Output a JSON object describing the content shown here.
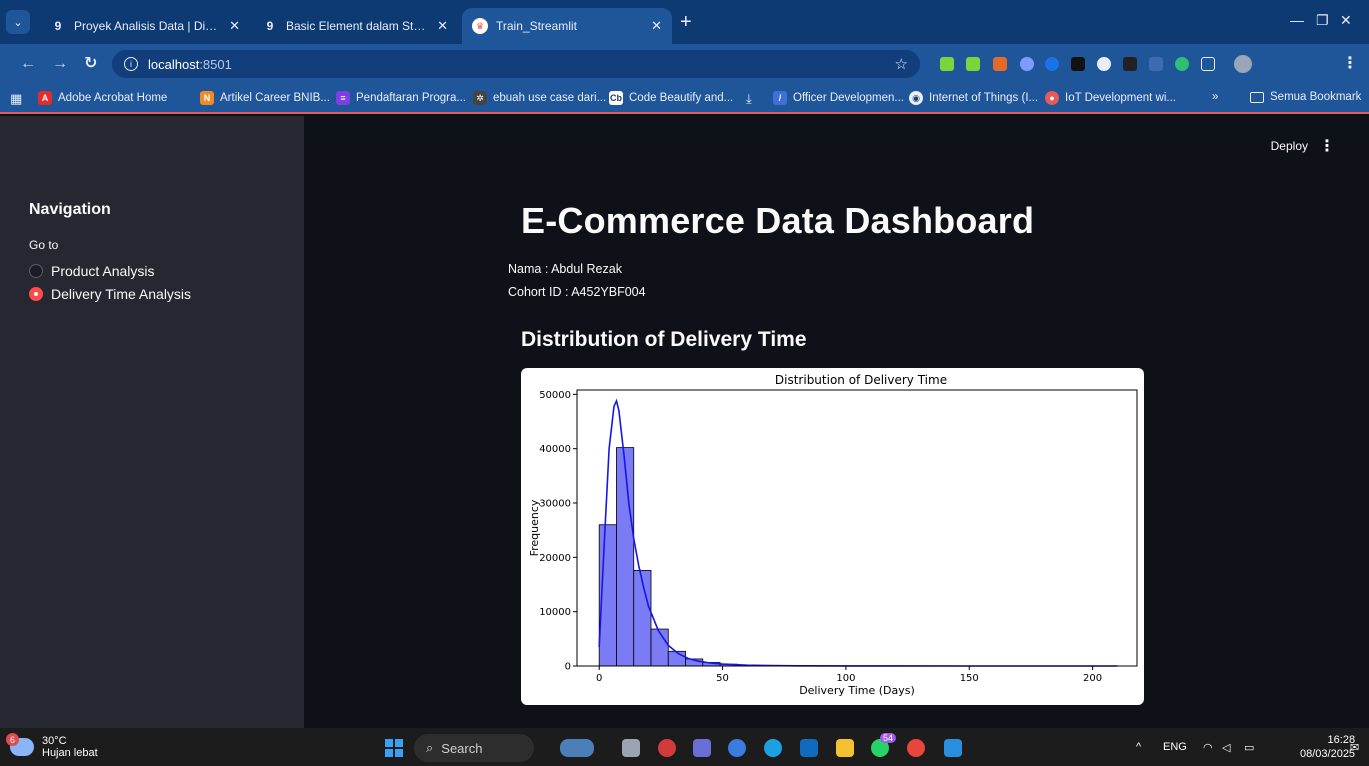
{
  "browser": {
    "tabs": [
      {
        "title": "Proyek Analisis Data | Dicoding",
        "icon": "dicoding-icon"
      },
      {
        "title": "Basic Element dalam Streamlit |",
        "icon": "dicoding-icon"
      },
      {
        "title": "Train_Streamlit",
        "icon": "streamlit-crown-icon"
      }
    ],
    "new_tab": "+",
    "address": {
      "host": "localhost",
      "port": ":8501"
    },
    "bookmarks": [
      "Adobe Acrobat Home",
      "Artikel Career BNIB...",
      "Pendaftaran Progra...",
      "ebuah use case dari...",
      "Code Beautify and...",
      "Officer Developmen...",
      "Internet of Things (I...",
      "IoT Development wi..."
    ],
    "bookmark_more": "»",
    "bookmark_folder": "Semua Bookmark"
  },
  "app": {
    "deploy_label": "Deploy",
    "sidebar": {
      "title": "Navigation",
      "radio_label": "Go to",
      "options": [
        "Product Analysis",
        "Delivery Time Analysis"
      ],
      "selected": "Delivery Time Analysis"
    },
    "main": {
      "title": "E-Commerce Data Dashboard",
      "name_line": "Nama : Abdul Rezak",
      "cohort_line": "Cohort ID : A452YBF004",
      "section_title": "Distribution of Delivery Time"
    }
  },
  "chart_data": {
    "type": "bar",
    "title": "Distribution of Delivery Time",
    "xlabel": "Delivery Time (Days)",
    "ylabel": "Frequency",
    "xlim": [
      -9,
      218
    ],
    "ylim": [
      0,
      50800
    ],
    "xticks": [
      0,
      50,
      100,
      150,
      200
    ],
    "yticks": [
      0,
      10000,
      20000,
      30000,
      40000,
      50000
    ],
    "bin_edges": [
      0,
      7,
      14,
      21,
      28,
      35,
      42,
      49,
      56,
      63,
      70,
      77,
      84,
      91,
      98,
      105,
      112,
      119,
      126,
      133,
      140,
      147,
      154,
      161,
      168,
      175,
      182,
      189,
      196,
      203,
      210
    ],
    "counts": [
      26000,
      40200,
      17600,
      6800,
      2700,
      1300,
      650,
      330,
      160,
      90,
      60,
      40,
      30,
      20,
      15,
      10,
      8,
      6,
      5,
      4,
      4,
      3,
      3,
      2,
      2,
      2,
      1,
      1,
      1,
      1
    ],
    "kde": {
      "x": [
        0,
        2,
        4,
        6,
        7,
        8,
        10,
        12,
        14,
        16,
        18,
        20,
        24,
        28,
        32,
        36,
        40,
        45,
        50,
        60,
        70,
        80,
        100,
        150,
        210
      ],
      "y": [
        3500,
        22000,
        40000,
        47800,
        48800,
        47000,
        39000,
        30000,
        23500,
        18500,
        14500,
        11000,
        6500,
        3800,
        2300,
        1400,
        900,
        550,
        350,
        150,
        70,
        40,
        15,
        5,
        2
      ]
    },
    "bar_color": "#7b7bf5",
    "kde_color": "#1616e6",
    "grid": false
  },
  "taskbar": {
    "weather_badge": "6",
    "temperature": "30°C",
    "condition": "Hujan lebat",
    "search_label": "Search",
    "whatsapp_badge": "54",
    "lang": "ENG",
    "time": "16:28",
    "date": "08/03/2025"
  }
}
